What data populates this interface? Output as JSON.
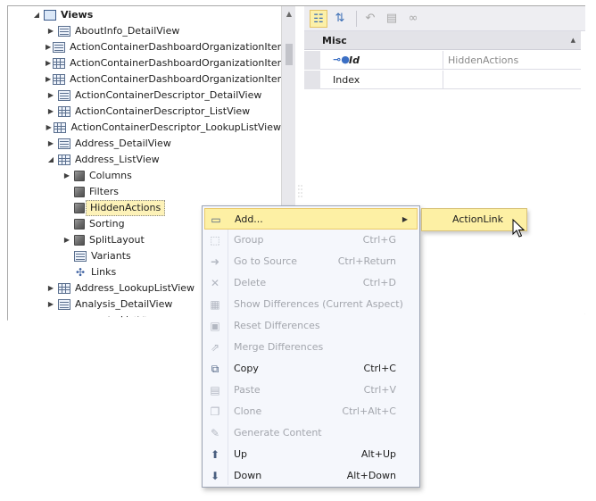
{
  "tree": {
    "root_label": "Views",
    "items": [
      {
        "label": "AboutInfo_DetailView",
        "icon": "detail-view-icon"
      },
      {
        "label": "ActionContainerDashboardOrganizationItem...",
        "icon": "detail-view-icon"
      },
      {
        "label": "ActionContainerDashboardOrganizationItem...",
        "icon": "list-view-icon"
      },
      {
        "label": "ActionContainerDashboardOrganizationItem...",
        "icon": "list-view-icon"
      },
      {
        "label": "ActionContainerDescriptor_DetailView",
        "icon": "detail-view-icon"
      },
      {
        "label": "ActionContainerDescriptor_ListView",
        "icon": "list-view-icon"
      },
      {
        "label": "ActionContainerDescriptor_LookupListView",
        "icon": "list-view-icon"
      },
      {
        "label": "Address_DetailView",
        "icon": "detail-view-icon"
      },
      {
        "label": "Address_ListView",
        "icon": "list-view-icon"
      },
      {
        "label": "Columns",
        "icon": "cube-icon"
      },
      {
        "label": "Filters",
        "icon": "cube-icon"
      },
      {
        "label": "HiddenActions",
        "icon": "cube-icon"
      },
      {
        "label": "Sorting",
        "icon": "cube-icon"
      },
      {
        "label": "SplitLayout",
        "icon": "cube-icon"
      },
      {
        "label": "Variants",
        "icon": "detail-view-icon"
      },
      {
        "label": "Links",
        "icon": "links-icon"
      },
      {
        "label": "Address_LookupListView",
        "icon": "list-view-icon"
      },
      {
        "label": "Analysis_DetailView",
        "icon": "detail-view-icon"
      },
      {
        "label": "Analysis_ListView",
        "icon": "list-view-icon"
      }
    ],
    "selected": "HiddenActions"
  },
  "properties": {
    "toolbar": [
      "categorized-icon",
      "alphabetical-icon",
      "undo-icon",
      "copy-icon",
      "link-icon"
    ],
    "category": "Misc",
    "rows": [
      {
        "name": "Id",
        "value": "HiddenActions"
      },
      {
        "name": "Index",
        "value": ""
      }
    ]
  },
  "context_menu": {
    "items": [
      {
        "label": "Add...",
        "shortcut": "",
        "icon": "add-icon"
      },
      {
        "label": "Group",
        "shortcut": "Ctrl+G",
        "icon": "group-icon"
      },
      {
        "label": "Go to Source",
        "shortcut": "Ctrl+Return",
        "icon": "go-to-source-icon"
      },
      {
        "label": "Delete",
        "shortcut": "Ctrl+D",
        "icon": "delete-icon"
      },
      {
        "label": "Show Differences (Current Aspect)",
        "shortcut": "",
        "icon": "show-differences-icon"
      },
      {
        "label": "Reset Differences",
        "shortcut": "",
        "icon": "reset-differences-icon"
      },
      {
        "label": "Merge Differences",
        "shortcut": "",
        "icon": "merge-differences-icon"
      },
      {
        "label": "Copy",
        "shortcut": "Ctrl+C",
        "icon": "copy-icon"
      },
      {
        "label": "Paste",
        "shortcut": "Ctrl+V",
        "icon": "paste-icon"
      },
      {
        "label": "Clone",
        "shortcut": "Ctrl+Alt+C",
        "icon": "clone-icon"
      },
      {
        "label": "Generate Content",
        "shortcut": "",
        "icon": "generate-content-icon"
      },
      {
        "label": "Up",
        "shortcut": "Alt+Up",
        "icon": "up-icon"
      },
      {
        "label": "Down",
        "shortcut": "Alt+Down",
        "icon": "down-icon"
      }
    ],
    "submenu": {
      "label": "ActionLink"
    }
  }
}
